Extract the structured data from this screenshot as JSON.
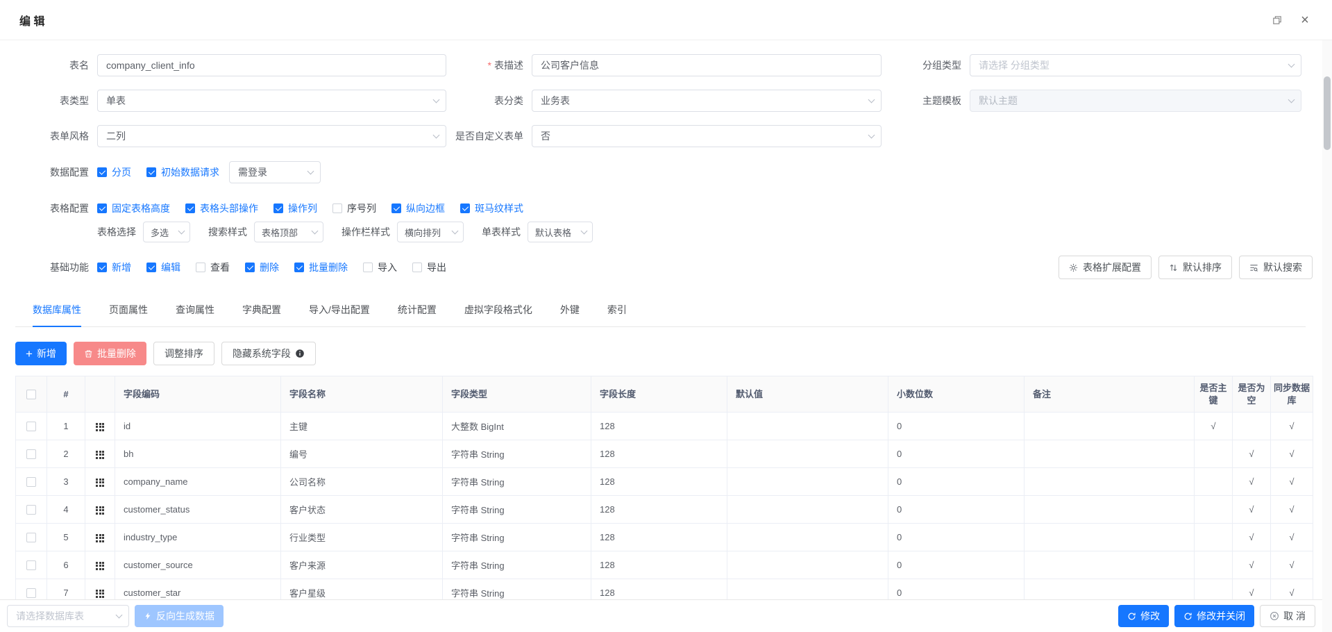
{
  "colors": {
    "primary": "#1677ff",
    "primary_disabled": "#9ec6ff",
    "danger_disabled": "#f78989"
  },
  "icons": {
    "plus": "+",
    "close": "×",
    "check_mark": "√"
  },
  "window": {
    "title": "编 辑"
  },
  "form": {
    "table_name": {
      "label": "表名",
      "value": "company_client_info"
    },
    "table_desc": {
      "label": "表描述",
      "required_mark": "*",
      "value": "公司客户信息"
    },
    "group_type": {
      "label": "分组类型",
      "placeholder": "请选择 分组类型"
    },
    "table_type": {
      "label": "表类型",
      "value": "单表"
    },
    "table_category": {
      "label": "表分类",
      "value": "业务表"
    },
    "theme_template": {
      "label": "主题模板",
      "value": "默认主题"
    },
    "form_style": {
      "label": "表单风格",
      "value": "二列"
    },
    "custom_form": {
      "label": "是否自定义表单",
      "value": "否"
    },
    "data_config": {
      "label": "数据配置",
      "checkboxes": [
        {
          "label": "分页",
          "checked": true
        },
        {
          "label": "初始数据请求",
          "checked": true
        }
      ],
      "auth_select_value": "需登录"
    },
    "table_config": {
      "label": "表格配置",
      "checkboxes": [
        {
          "label": "固定表格高度",
          "checked": true
        },
        {
          "label": "表格头部操作",
          "checked": true
        },
        {
          "label": "操作列",
          "checked": true
        },
        {
          "label": "序号列",
          "checked": false
        },
        {
          "label": "纵向边框",
          "checked": true
        },
        {
          "label": "斑马纹样式",
          "checked": true
        }
      ],
      "selects": [
        {
          "label": "表格选择",
          "value": "多选"
        },
        {
          "label": "搜索样式",
          "value": "表格顶部"
        },
        {
          "label": "操作栏样式",
          "value": "横向排列"
        },
        {
          "label": "单表样式",
          "value": "默认表格"
        }
      ]
    },
    "basic_functions": {
      "label": "基础功能",
      "checkboxes": [
        {
          "label": "新增",
          "checked": true
        },
        {
          "label": "编辑",
          "checked": true
        },
        {
          "label": "查看",
          "checked": false
        },
        {
          "label": "删除",
          "checked": true
        },
        {
          "label": "批量删除",
          "checked": true
        },
        {
          "label": "导入",
          "checked": false
        },
        {
          "label": "导出",
          "checked": false
        }
      ],
      "expand_config_button": "表格扩展配置",
      "default_sort_button": "默认排序",
      "default_search_button": "默认搜索"
    }
  },
  "tabs": [
    {
      "label": "数据库属性",
      "active": true
    },
    {
      "label": "页面属性",
      "active": false
    },
    {
      "label": "查询属性",
      "active": false
    },
    {
      "label": "字典配置",
      "active": false
    },
    {
      "label": "导入/导出配置",
      "active": false
    },
    {
      "label": "统计配置",
      "active": false
    },
    {
      "label": "虚拟字段格式化",
      "active": false
    },
    {
      "label": "外键",
      "active": false
    },
    {
      "label": "索引",
      "active": false
    }
  ],
  "toolbar": {
    "add": "新增",
    "batch_delete": "批量删除",
    "adjust_sort": "调整排序",
    "hide_system_fields": "隐藏系统字段"
  },
  "table": {
    "headers": [
      "#",
      "字段编码",
      "字段名称",
      "字段类型",
      "字段长度",
      "默认值",
      "小数位数",
      "备注",
      "是否主键",
      "是否为空",
      "同步数据库"
    ],
    "rows": [
      {
        "num": "1",
        "code": "id",
        "name": "主键",
        "type": "大整数 BigInt",
        "length": "128",
        "default": "",
        "decimal": "0",
        "remark": "",
        "pk": "√",
        "nullable": "",
        "sync": "√"
      },
      {
        "num": "2",
        "code": "bh",
        "name": "编号",
        "type": "字符串 String",
        "length": "128",
        "default": "",
        "decimal": "0",
        "remark": "",
        "pk": "",
        "nullable": "√",
        "sync": "√"
      },
      {
        "num": "3",
        "code": "company_name",
        "name": "公司名称",
        "type": "字符串 String",
        "length": "128",
        "default": "",
        "decimal": "0",
        "remark": "",
        "pk": "",
        "nullable": "√",
        "sync": "√"
      },
      {
        "num": "4",
        "code": "customer_status",
        "name": "客户状态",
        "type": "字符串 String",
        "length": "128",
        "default": "",
        "decimal": "0",
        "remark": "",
        "pk": "",
        "nullable": "√",
        "sync": "√"
      },
      {
        "num": "5",
        "code": "industry_type",
        "name": "行业类型",
        "type": "字符串 String",
        "length": "128",
        "default": "",
        "decimal": "0",
        "remark": "",
        "pk": "",
        "nullable": "√",
        "sync": "√"
      },
      {
        "num": "6",
        "code": "customer_source",
        "name": "客户来源",
        "type": "字符串 String",
        "length": "128",
        "default": "",
        "decimal": "0",
        "remark": "",
        "pk": "",
        "nullable": "√",
        "sync": "√"
      },
      {
        "num": "7",
        "code": "customer_star",
        "name": "客户星级",
        "type": "字符串 String",
        "length": "128",
        "default": "",
        "decimal": "0",
        "remark": "",
        "pk": "",
        "nullable": "√",
        "sync": "√"
      }
    ]
  },
  "footer": {
    "db_table_select_placeholder": "请选择数据库表",
    "reverse_generate": "反向生成数据",
    "modify": "修改",
    "modify_and_close": "修改并关闭",
    "cancel": "取 消"
  }
}
